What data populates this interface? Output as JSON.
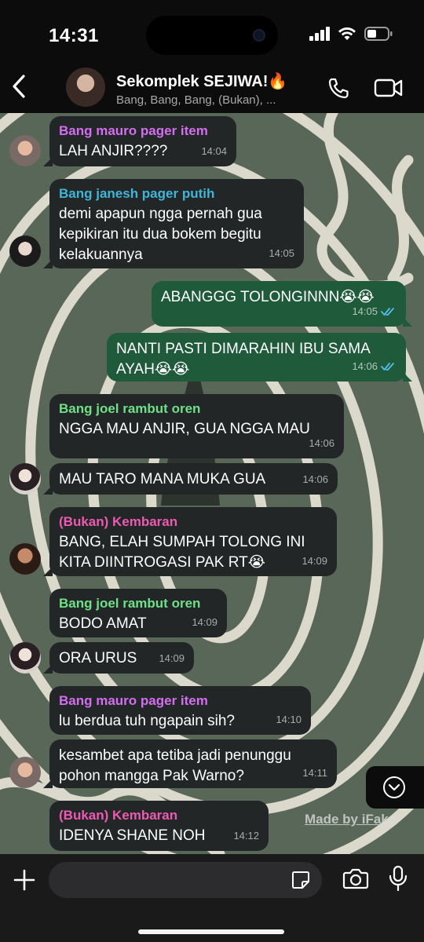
{
  "status": {
    "time": "14:31"
  },
  "header": {
    "title": "Sekomplek SEJIWA!🔥",
    "subtitle": "Bang, Bang, Bang, (Bukan), ..."
  },
  "messages": [
    {
      "sender": "Bang mauro pager item",
      "sender_color": "#d36ef0",
      "text": "LAH ANJIR????",
      "time": "14:04"
    },
    {
      "sender": "Bang janesh pager putih",
      "sender_color": "#3fb6d8",
      "text": "demi apapun ngga pernah gua\nkepikiran itu dua bokem begitu\nkelakuannya",
      "time": "14:05"
    },
    {
      "text": "ABANGGG TOLONGINNN😭😭",
      "time": "14:05",
      "outgoing": true
    },
    {
      "text": "NANTI PASTI DIMARAHIN IBU SAMA\nAYAH😭😭",
      "time": "14:06",
      "outgoing": true
    },
    {
      "sender": "Bang joel rambut oren",
      "sender_color": "#6fe087",
      "text": "NGGA MAU ANJIR, GUA NGGA MAU",
      "time": "14:06"
    },
    {
      "text": "MAU TARO MANA MUKA GUA",
      "time": "14:06"
    },
    {
      "sender": "(Bukan) Kembaran",
      "sender_color": "#ec5ab3",
      "text": "BANG, ELAH SUMPAH TOLONG INI\nKITA DIINTROGASI PAK RT😭",
      "time": "14:09"
    },
    {
      "sender": "Bang joel rambut oren",
      "sender_color": "#6fe087",
      "text": "BODO AMAT",
      "time": "14:09"
    },
    {
      "text": "ORA URUS",
      "time": "14:09"
    },
    {
      "sender": "Bang mauro pager item",
      "sender_color": "#d36ef0",
      "text": "lu berdua tuh ngapain sih?",
      "time": "14:10"
    },
    {
      "text": "kesambet apa tetiba jadi penunggu\npohon mangga Pak Warno?",
      "time": "14:11"
    },
    {
      "sender": "(Bukan) Kembaran",
      "sender_color": "#ec5ab3",
      "text": "IDENYA SHANE NOH",
      "time": "14:12"
    }
  ],
  "watermark": "Made by iFake",
  "colors": {
    "incoming_bubble": "#232626",
    "outgoing_bubble": "#1f5a3b",
    "read_ticks": "#53bdeb",
    "wallpaper": "#596758"
  }
}
